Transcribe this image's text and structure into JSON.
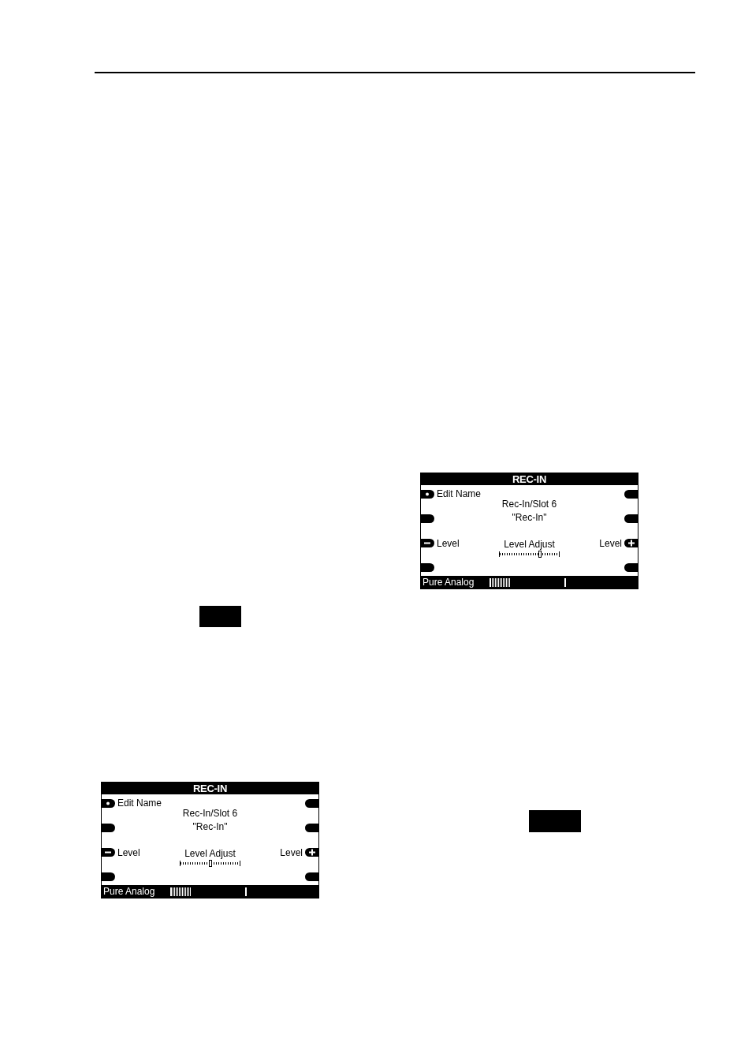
{
  "screens": [
    {
      "title": "REC-IN",
      "left_keys": [
        {
          "kind": "dot",
          "label": "Edit Name"
        },
        {
          "kind": "blank"
        },
        {
          "kind": "minus",
          "label": "Level"
        },
        {
          "kind": "blank"
        }
      ],
      "right_keys": [
        {
          "kind": "blank"
        },
        {
          "kind": "blank"
        },
        {
          "kind": "plus",
          "label": "Level"
        },
        {
          "kind": "blank"
        }
      ],
      "info": [
        "Rec-In/Slot 6",
        "\"Rec-In\""
      ],
      "slider": {
        "label": "Level Adjust",
        "level": 0.68
      },
      "status": {
        "label": "Pure Analog"
      }
    },
    {
      "title": "REC-IN",
      "left_keys": [
        {
          "kind": "dot",
          "label": "Edit Name"
        },
        {
          "kind": "blank"
        },
        {
          "kind": "minus",
          "label": "Level"
        },
        {
          "kind": "blank"
        }
      ],
      "right_keys": [
        {
          "kind": "blank"
        },
        {
          "kind": "blank"
        },
        {
          "kind": "plus",
          "label": "Level"
        },
        {
          "kind": "blank"
        }
      ],
      "info": [
        "Rec-In/Slot 6",
        "\"Rec-In\""
      ],
      "slider": {
        "label": "Level Adjust",
        "level": 0.5
      },
      "status": {
        "label": "Pure Analog"
      }
    }
  ]
}
